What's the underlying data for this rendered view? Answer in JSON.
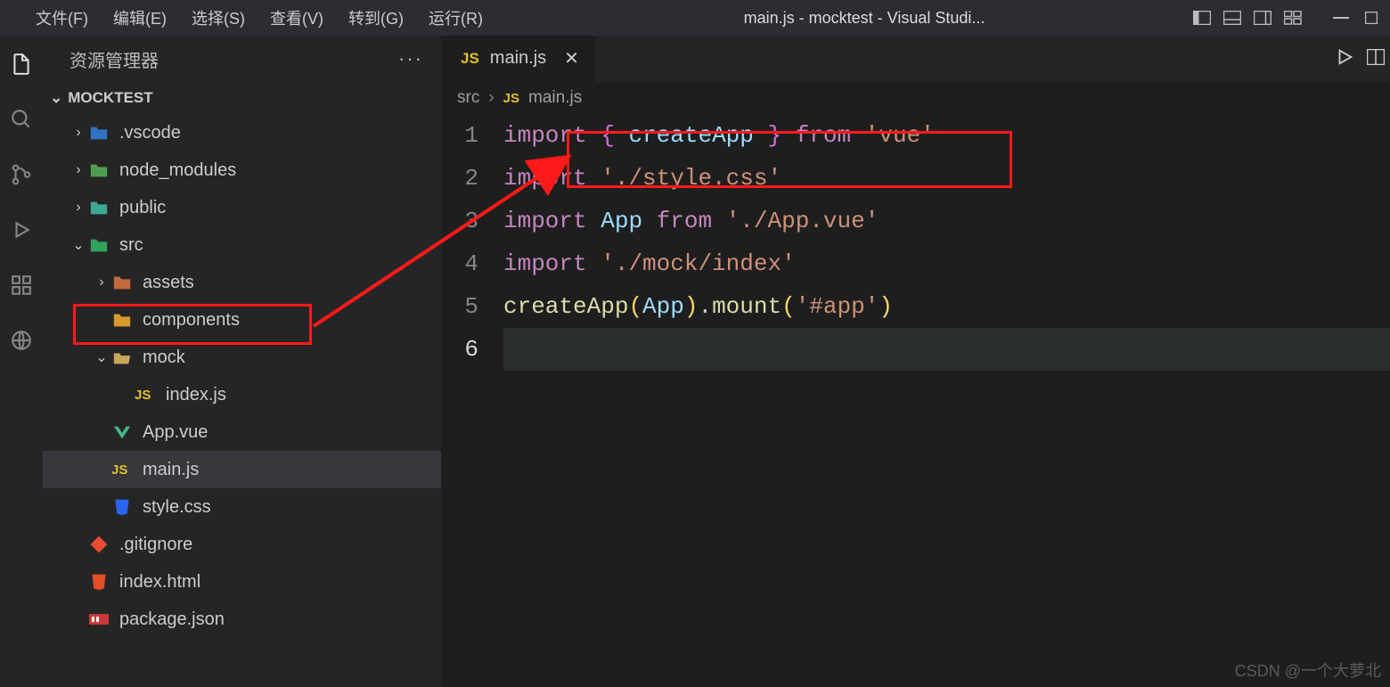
{
  "window_title": "main.js - mocktest - Visual Studi...",
  "menu": {
    "file": "文件(F)",
    "edit": "编辑(E)",
    "select": "选择(S)",
    "view": "查看(V)",
    "goto": "转到(G)",
    "run": "运行(R)"
  },
  "sidebar": {
    "title": "资源管理器",
    "project": "MOCKTEST",
    "tree": {
      "vscode": ".vscode",
      "node_modules": "node_modules",
      "public": "public",
      "src": "src",
      "assets": "assets",
      "components": "components",
      "mock": "mock",
      "index_js": "index.js",
      "app_vue": "App.vue",
      "main_js": "main.js",
      "style_css": "style.css",
      "gitignore": ".gitignore",
      "index_html": "index.html",
      "package_json": "package.json"
    }
  },
  "tab": {
    "label": "main.js",
    "icon_label": "JS"
  },
  "breadcrumb": {
    "seg1": "src",
    "seg2_icon": "JS",
    "seg2": "main.js"
  },
  "code": {
    "gutter": [
      "1",
      "2",
      "3",
      "4",
      "5",
      "6"
    ],
    "line1": {
      "kw": "import",
      "brace_l": "{",
      "var": "createApp",
      "brace_r": "}",
      "from": "from",
      "str": "'vue'"
    },
    "line2": {
      "kw": "import",
      "str": "'./style.css'"
    },
    "line3": {
      "kw": "import",
      "var": "App",
      "from": "from",
      "str": "'./App.vue'"
    },
    "line4": {
      "kw": "import",
      "str": "'./mock/index'"
    },
    "line5": {
      "fn": "createApp",
      "paren_l": "(",
      "arg": "App",
      "paren_r": ")",
      "dot": ".",
      "method": "mount",
      "paren_l2": "(",
      "str": "'#app'",
      "paren_r2": ")"
    }
  },
  "watermark": "CSDN @一个大萝北"
}
